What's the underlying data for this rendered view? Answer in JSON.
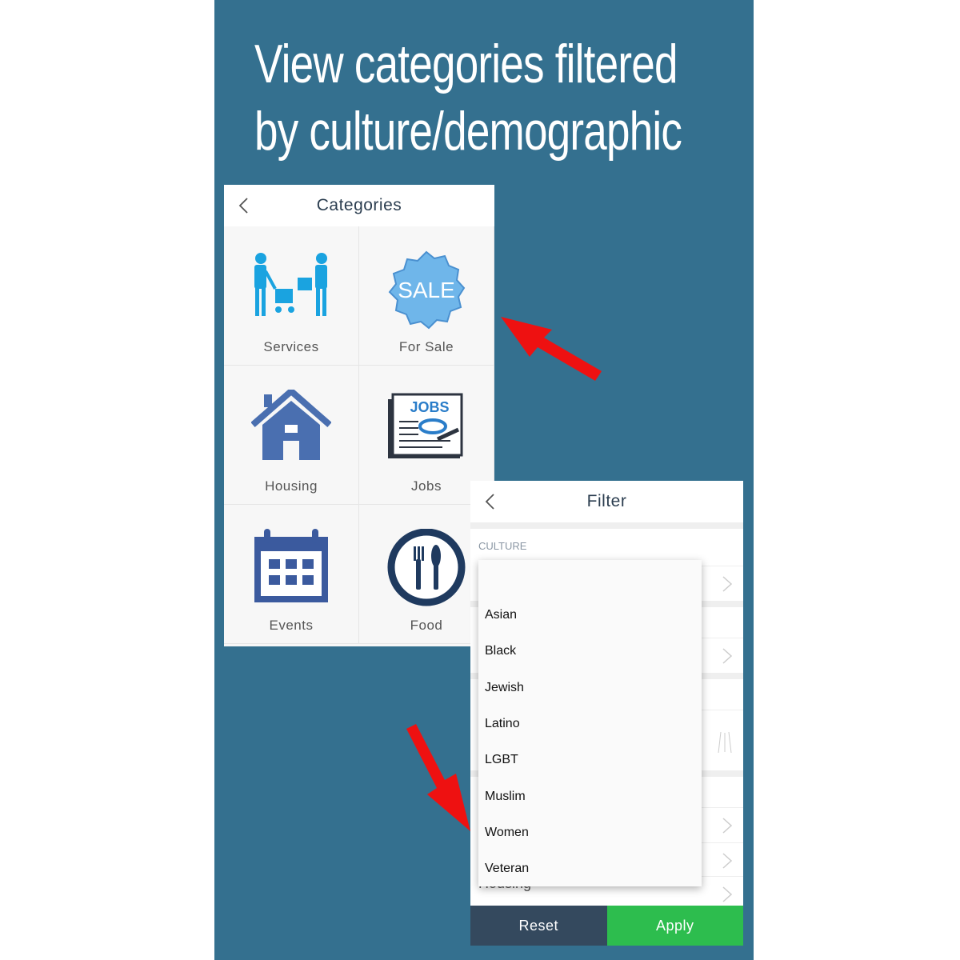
{
  "headline": {
    "line1": "View categories filtered",
    "line2": "by culture/demographic"
  },
  "categories": {
    "title": "Categories",
    "items": [
      {
        "label": "Services",
        "icon": "services-icon"
      },
      {
        "label": "For Sale",
        "icon": "sale-badge-icon",
        "badge_text": "SALE"
      },
      {
        "label": "Housing",
        "icon": "house-icon"
      },
      {
        "label": "Jobs",
        "icon": "jobs-newspaper-icon",
        "badge_text": "JOBS"
      },
      {
        "label": "Events",
        "icon": "calendar-icon"
      },
      {
        "label": "Food",
        "icon": "fork-knife-icon"
      }
    ]
  },
  "filter": {
    "title": "Filter",
    "section_label": "CULTURE",
    "partial_row_text": "Housing",
    "dropdown_options": [
      "Asian",
      "Black",
      "Jewish",
      "Latino",
      "LGBT",
      "Muslim",
      "Women",
      "Veteran"
    ],
    "reset_label": "Reset",
    "apply_label": "Apply"
  },
  "colors": {
    "background": "#34708f",
    "apply": "#2dbd4e",
    "reset": "#34495e",
    "arrow": "#ee1111",
    "icon_blue": "#1aa3e0",
    "icon_navy": "#3b5a9e"
  }
}
